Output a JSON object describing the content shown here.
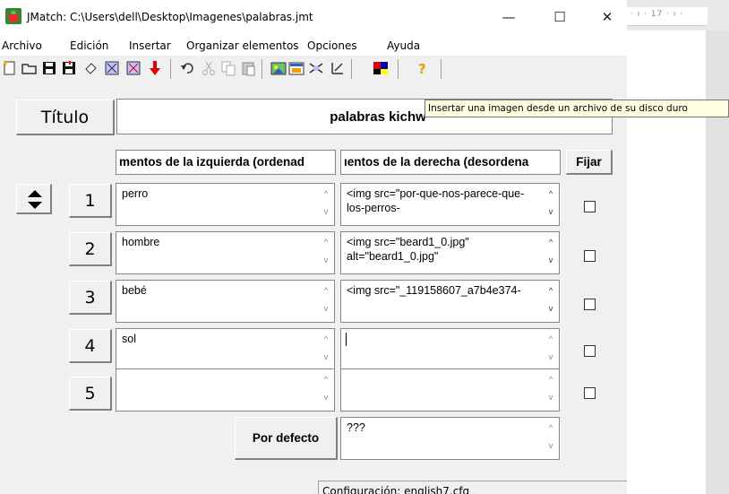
{
  "window": {
    "title": "JMatch: C:\\Users\\dell\\Desktop\\Imagenes\\palabras.jmt",
    "minimize": "—",
    "maximize": "☐",
    "close": "✕"
  },
  "menu": [
    "Archivo",
    "Edición",
    "Insertar",
    "Organizar elementos",
    "Opciones",
    "Ayuda"
  ],
  "toolbar": {
    "icons": [
      "new-file-icon",
      "open-folder-icon",
      "save-icon",
      "save-as-icon",
      "eraser-icon",
      "create-webpage-icon",
      "create-dragdrop-icon",
      "insert-arrow-icon",
      "undo-icon",
      "cut-icon",
      "copy-icon",
      "paste-icon",
      "insert-image-icon",
      "insert-link-icon",
      "shuffle-icon",
      "sort-icon",
      "color-icon",
      "help-icon"
    ]
  },
  "ruler": {
    "text": "· ı · 17 · ı ·"
  },
  "titulo": {
    "label": "Título",
    "value": "palabras kichw"
  },
  "tooltip": "Insertar una imagen desde un archivo de su disco duro",
  "headers": {
    "left": "mentos de la izquierda (ordenad",
    "right": "ıentos de la derecha (desordena",
    "fijar": "Fijar"
  },
  "rows": [
    {
      "num": "1",
      "left": "perro",
      "right": "<img src=\"por-que-nos-parece-que-los-perros-"
    },
    {
      "num": "2",
      "left": "hombre",
      "right": "<img src=\"beard1_0.jpg\" alt=\"beard1_0.jpg\""
    },
    {
      "num": "3",
      "left": "bebé",
      "right": "<img src=\"_119158607_a7b4e374-"
    },
    {
      "num": "4",
      "left": "sol",
      "right": ""
    },
    {
      "num": "5",
      "left": "",
      "right": ""
    }
  ],
  "default_button": "Por defecto",
  "default_value": "???",
  "status": "Configuración: english7.cfg"
}
